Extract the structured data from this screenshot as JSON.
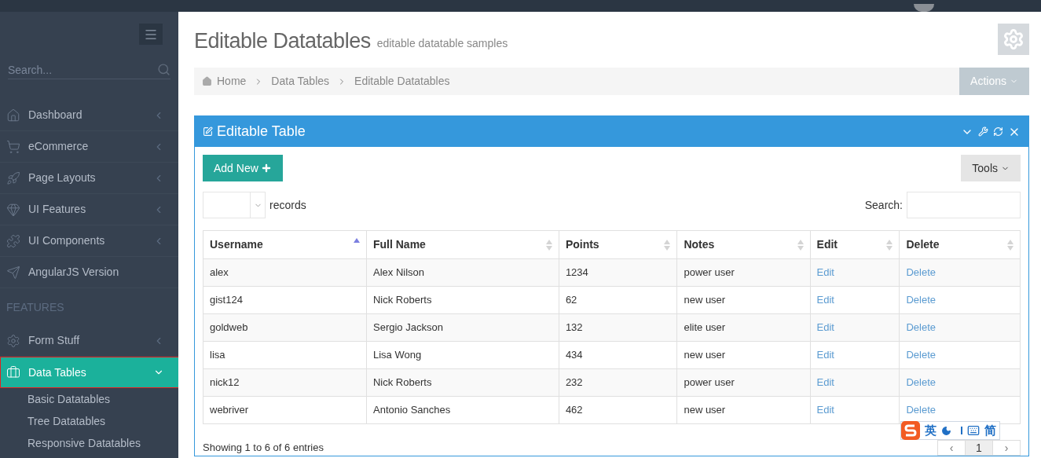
{
  "sidebar": {
    "search": {
      "placeholder": "Search..."
    },
    "items": [
      {
        "kind": "link",
        "label": "Dashboard",
        "expandable": true,
        "selected": false,
        "highlighted": false
      },
      {
        "kind": "link",
        "label": "eCommerce",
        "expandable": true,
        "selected": false,
        "highlighted": false
      },
      {
        "kind": "link",
        "label": "Page Layouts",
        "expandable": true,
        "selected": false,
        "highlighted": false
      },
      {
        "kind": "link",
        "label": "UI Features",
        "expandable": true,
        "selected": false,
        "highlighted": false
      },
      {
        "kind": "link",
        "label": "UI Components",
        "expandable": true,
        "selected": false,
        "highlighted": false
      },
      {
        "kind": "link",
        "label": "AngularJS Version",
        "expandable": false,
        "selected": false,
        "highlighted": false
      },
      {
        "kind": "heading",
        "label": "FEATURES"
      },
      {
        "kind": "link",
        "label": "Form Stuff",
        "expandable": true,
        "selected": false,
        "highlighted": false
      },
      {
        "kind": "link",
        "label": "Data Tables",
        "expandable": true,
        "selected": true,
        "highlighted": true,
        "children": [
          {
            "label": "Basic Datatables"
          },
          {
            "label": "Tree Datatables"
          },
          {
            "label": "Responsive Datatables"
          }
        ]
      }
    ]
  },
  "page": {
    "title": "Editable Datatables",
    "subtitle": "editable datatable samples"
  },
  "breadcrumb": [
    "Home",
    "Data Tables",
    "Editable Datatables"
  ],
  "actions_button": "Actions",
  "panel": {
    "title": "Editable Table",
    "add_button": "Add New",
    "tools_button": "Tools",
    "records_label": "records",
    "search_label": "Search:",
    "table": {
      "columns": [
        {
          "label": "Username",
          "sorted": true
        },
        {
          "label": "Full Name",
          "sorted": false
        },
        {
          "label": "Points",
          "sorted": false
        },
        {
          "label": "Notes",
          "sorted": false
        },
        {
          "label": "Edit",
          "sorted": false
        },
        {
          "label": "Delete",
          "sorted": false
        }
      ],
      "rows": [
        [
          "alex",
          "Alex Nilson",
          "1234",
          "power user",
          "Edit",
          "Delete"
        ],
        [
          "gist124",
          "Nick Roberts",
          "62",
          "new user",
          "Edit",
          "Delete"
        ],
        [
          "goldweb",
          "Sergio Jackson",
          "132",
          "elite user",
          "Edit",
          "Delete"
        ],
        [
          "lisa",
          "Lisa Wong",
          "434",
          "new user",
          "Edit",
          "Delete"
        ],
        [
          "nick12",
          "Nick Roberts",
          "232",
          "power user",
          "Edit",
          "Delete"
        ],
        [
          "webriver",
          "Antonio Sanches",
          "462",
          "new user",
          "Edit",
          "Delete"
        ]
      ]
    },
    "info": "Showing 1 to 6 of 6 entries",
    "pagination": [
      {
        "label": "‹",
        "selected": false
      },
      {
        "label": "1",
        "selected": true
      },
      {
        "label": "›",
        "selected": false
      }
    ]
  },
  "ime_toolbar": {
    "language": "英",
    "script": "简"
  }
}
